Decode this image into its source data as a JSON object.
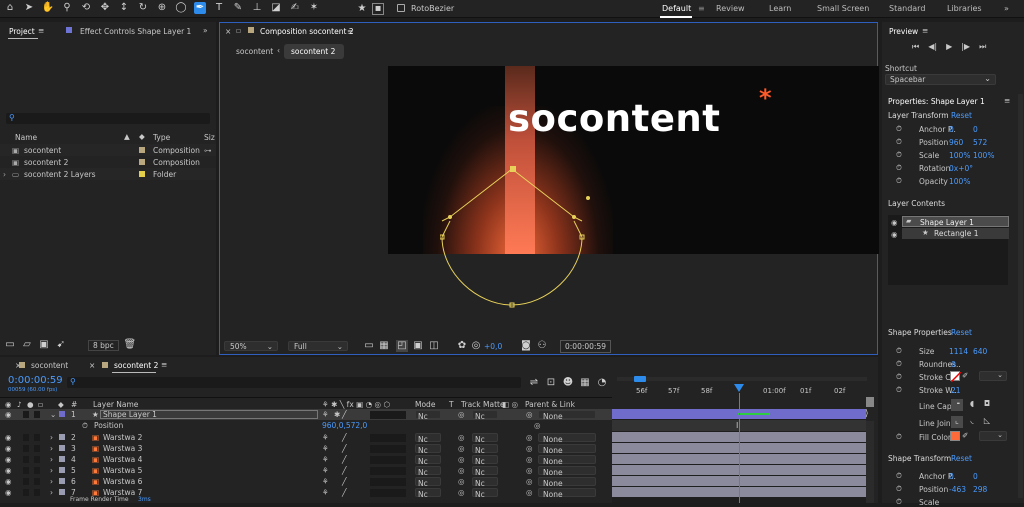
{
  "toolbar": {
    "rotobezier_label": "RotoBezier",
    "workspaces": [
      "Default",
      "Review",
      "Learn",
      "Small Screen",
      "Standard",
      "Libraries"
    ]
  },
  "project": {
    "tab": "Project",
    "effect_tab": "Effect Controls Shape Layer 1",
    "search_placeholder": "",
    "col_name": "Name",
    "col_type": "Type",
    "col_size": "Siz",
    "items": [
      {
        "name": "socontent",
        "type": "Composition",
        "color": "#b9a780"
      },
      {
        "name": "socontent 2",
        "type": "Composition",
        "color": "#b9a780"
      },
      {
        "name": "socontent 2 Layers",
        "type": "Folder",
        "color": "#e3cf4a"
      }
    ],
    "bpc": "8 bpc"
  },
  "comp": {
    "tab": "Composition socontent 2",
    "crumbs": [
      "socontent",
      "socontent 2"
    ],
    "logo_text": "socontent",
    "asterisk": "*",
    "zoom": "50%",
    "quality": "Full",
    "exposure": "+0,0",
    "timecode": "0:00:00:59"
  },
  "preview": {
    "title": "Preview",
    "shortcut_label": "Shortcut",
    "shortcut_value": "Spacebar"
  },
  "properties": {
    "title": "Properties: Shape Layer 1",
    "layer_transform": "Layer Transform",
    "reset": "Reset",
    "anchor_label": "Anchor P..",
    "anchor_x": "0",
    "anchor_y": "0",
    "position_label": "Position",
    "position_x": "960",
    "position_y": "572",
    "scale_label": "Scale",
    "scale_x": "100%",
    "scale_y": "100%",
    "rotation_label": "Rotation",
    "rotation_value": "0x+0°",
    "opacity_label": "Opacity",
    "opacity_value": "100%",
    "layer_contents": "Layer Contents",
    "content_items": [
      "Shape Layer 1",
      "Rectangle 1"
    ],
    "shape_properties": "Shape Properties",
    "size_label": "Size",
    "size_x": "1114",
    "size_y": "640",
    "roundness_label": "Roundnes..",
    "roundness_value": "0",
    "stroke_color_label": "Stroke Co..",
    "stroke_width_label": "Stroke W..",
    "stroke_width_value": "21",
    "line_cap_label": "Line Cap",
    "line_join_label": "Line Join",
    "fill_color_label": "Fill Color",
    "shape_transform": "Shape Transform",
    "st_anchor_x": "0",
    "st_anchor_y": "0",
    "st_position_x": "-463",
    "st_position_y": "298",
    "st_scale_label": "Scale",
    "fill_color": "#ff6a3a"
  },
  "timeline": {
    "tabs": [
      "socontent",
      "socontent 2"
    ],
    "timecode": "0:00:00:59",
    "timecode_sub": "00059 (60.00 fps)",
    "col_layer_name": "Layer Name",
    "col_mode": "Mode",
    "col_t": "T",
    "col_track_matte": "Track Matte",
    "col_parent": "Parent & Link",
    "ruler": [
      "56f",
      "57f",
      "58f",
      "01:00f",
      "01f",
      "02f"
    ],
    "position_label": "Position",
    "position_value": "960,0,572,0",
    "frame_render_label": "Frame Render Time",
    "frame_render_value": "3ms",
    "layers": [
      {
        "num": "1",
        "name": "Shape Layer 1",
        "mode": "Nc",
        "parent": "None",
        "color": "#6f6ccc"
      },
      {
        "num": "2",
        "name": "Warstwa 2",
        "mode": "Nc",
        "parent": "None",
        "color": "#9a9db2"
      },
      {
        "num": "3",
        "name": "Warstwa 3",
        "mode": "Nc",
        "parent": "None",
        "color": "#9a9db2"
      },
      {
        "num": "4",
        "name": "Warstwa 4",
        "mode": "Nc",
        "parent": "None",
        "color": "#9a9db2"
      },
      {
        "num": "5",
        "name": "Warstwa 5",
        "mode": "Nc",
        "parent": "None",
        "color": "#9a9db2"
      },
      {
        "num": "6",
        "name": "Warstwa 6",
        "mode": "Nc",
        "parent": "None",
        "color": "#9a9db2"
      },
      {
        "num": "7",
        "name": "Warstwa 7",
        "mode": "Nc",
        "parent": "None",
        "color": "#9a9db2"
      }
    ]
  }
}
